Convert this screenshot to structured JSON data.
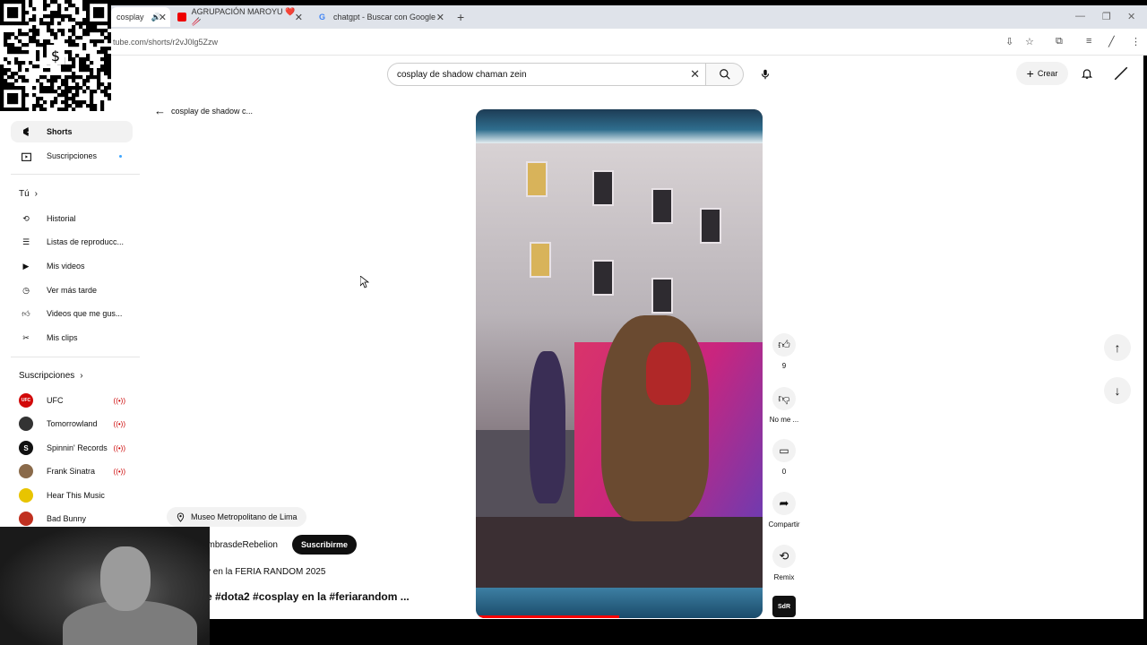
{
  "browser": {
    "tabs": [
      {
        "label": "cosplay",
        "active": true,
        "audio": true
      },
      {
        "label": "AGRUPACIÓN MAROYU ❤️🥢",
        "active": false
      },
      {
        "label": "chatgpt - Buscar con Google",
        "active": false
      }
    ],
    "url": "tube.com/shorts/r2vJ0lg5Zzw"
  },
  "header": {
    "search_value": "cosplay de shadow chaman zein",
    "create_label": "Crear"
  },
  "sidebar": {
    "items": [
      {
        "label": "Shorts",
        "icon": "shorts-icon",
        "selected": true
      },
      {
        "label": "Suscripciones",
        "icon": "subscriptions-icon",
        "new_dot": true
      }
    ],
    "you_heading": "Tú",
    "you_items": [
      {
        "label": "Historial",
        "icon": "history-icon"
      },
      {
        "label": "Listas de reproducc...",
        "icon": "playlist-icon"
      },
      {
        "label": "Mis videos",
        "icon": "video-icon"
      },
      {
        "label": "Ver más tarde",
        "icon": "clock-icon"
      },
      {
        "label": "Videos que me gus...",
        "icon": "thumbs-up-icon"
      },
      {
        "label": "Mis clips",
        "icon": "scissors-icon"
      }
    ],
    "subs_heading": "Suscripciones",
    "subscriptions": [
      {
        "label": "UFC",
        "color": "#d20a0a",
        "live": true
      },
      {
        "label": "Tomorrowland",
        "color": "#333333",
        "live": true
      },
      {
        "label": "Spinnin' Records",
        "color": "#111111",
        "live": true
      },
      {
        "label": "Frank Sinatra",
        "color": "#8a6a4a",
        "live": true
      },
      {
        "label": "Hear This Music",
        "color": "#e8c400",
        "live": false
      },
      {
        "label": "Bad Bunny",
        "color": "#c03020",
        "live": false
      }
    ]
  },
  "shorts": {
    "back_label": "cosplay de shadow c...",
    "location": "Museo Metropolitano de Lima",
    "channel": "ombrasdeRebelion",
    "subscribe_label": "Suscribirme",
    "description": "y en la FERIA RANDOM 2025",
    "title": "e #dota2 #cosplay en la #feriarandom ...",
    "likes": "9",
    "dislike_label": "No me ...",
    "comments": "0",
    "share_label": "Compartir",
    "remix_label": "Remix",
    "channel_thumb": "SdR",
    "progress_fraction": 0.5
  }
}
